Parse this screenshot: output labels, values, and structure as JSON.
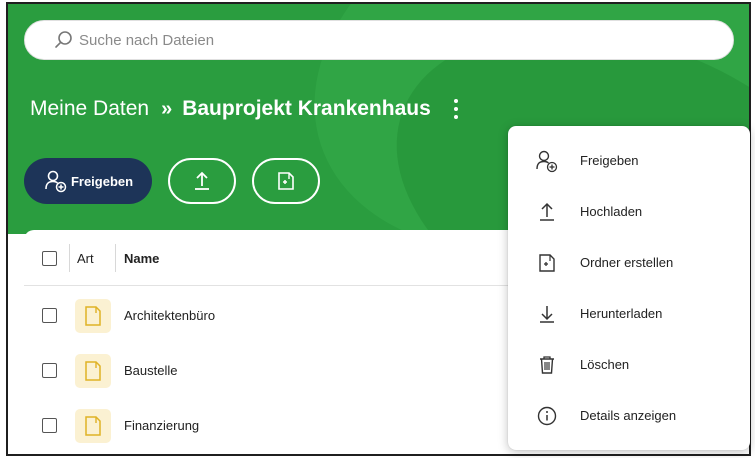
{
  "search": {
    "placeholder": "Suche nach Dateien"
  },
  "breadcrumb": {
    "root": "Meine Daten",
    "separator": "»",
    "current": "Bauprojekt Krankenhaus"
  },
  "toolbar": {
    "share_label": "Freigeben"
  },
  "table": {
    "columns": {
      "art": "Art",
      "name": "Name"
    },
    "rows": [
      {
        "name": "Architektenbüro",
        "type": "folder-icon"
      },
      {
        "name": "Baustelle",
        "type": "folder-icon"
      },
      {
        "name": "Finanzierung",
        "type": "folder-icon"
      }
    ]
  },
  "menu": {
    "items": [
      {
        "label": "Freigeben",
        "icon": "share-user-icon"
      },
      {
        "label": "Hochladen",
        "icon": "upload-icon"
      },
      {
        "label": "Ordner erstellen",
        "icon": "new-folder-icon"
      },
      {
        "label": "Herunterladen",
        "icon": "download-icon"
      },
      {
        "label": "Löschen",
        "icon": "trash-icon"
      },
      {
        "label": "Details anzeigen",
        "icon": "info-icon"
      }
    ]
  },
  "colors": {
    "header_green": "#2a9d3f",
    "share_button": "#1d3458",
    "folder_bg": "#fbf1d2",
    "folder_stroke": "#e0b225"
  }
}
